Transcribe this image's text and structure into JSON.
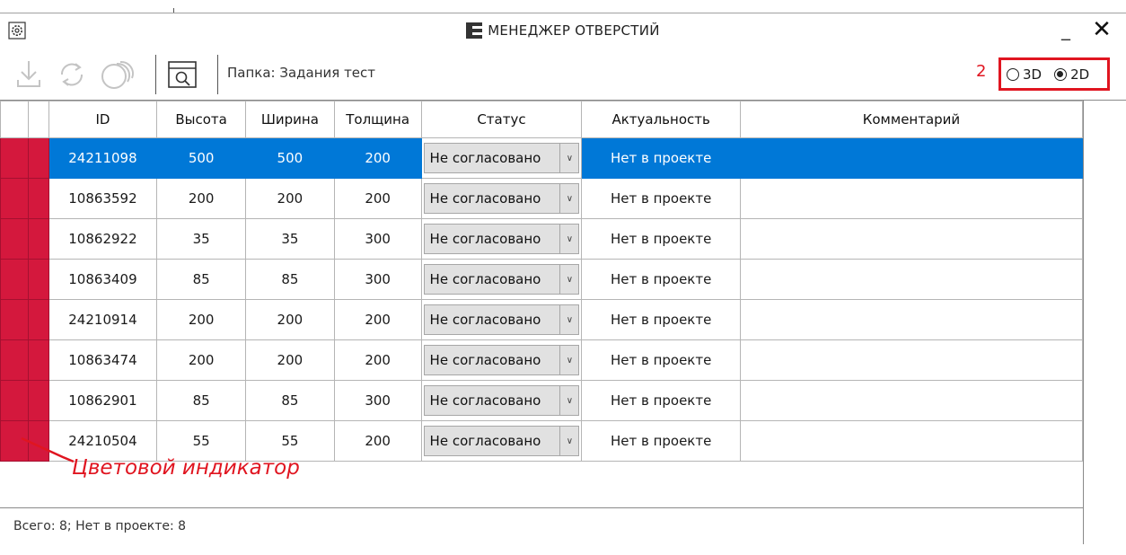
{
  "window": {
    "title": "МЕНЕДЖЕР ОТВЕРСТИЙ",
    "minimize": "_",
    "close": "✕"
  },
  "toolbar": {
    "folder_label": "Папка: Задания тест",
    "icons": [
      "download-icon",
      "refresh-icon",
      "circles-icon",
      "folder-search-icon"
    ],
    "annotation_number": "2",
    "mode": {
      "opt3d": "3D",
      "opt2d": "2D",
      "selected": "2D"
    }
  },
  "grid": {
    "headers": [
      "ID",
      "Высота",
      "Ширина",
      "Толщина",
      "Статус",
      "Актуальность",
      "Комментарий"
    ],
    "rows": [
      {
        "id": "24211098",
        "h": "500",
        "w": "500",
        "t": "200",
        "status": "Не согласовано",
        "actual": "Нет в проекте",
        "comment": ""
      },
      {
        "id": "10863592",
        "h": "200",
        "w": "200",
        "t": "200",
        "status": "Не согласовано",
        "actual": "Нет в проекте",
        "comment": ""
      },
      {
        "id": "10862922",
        "h": "35",
        "w": "35",
        "t": "300",
        "status": "Не согласовано",
        "actual": "Нет в проекте",
        "comment": ""
      },
      {
        "id": "10863409",
        "h": "85",
        "w": "85",
        "t": "300",
        "status": "Не согласовано",
        "actual": "Нет в проекте",
        "comment": ""
      },
      {
        "id": "24210914",
        "h": "200",
        "w": "200",
        "t": "200",
        "status": "Не согласовано",
        "actual": "Нет в проекте",
        "comment": ""
      },
      {
        "id": "10863474",
        "h": "200",
        "w": "200",
        "t": "200",
        "status": "Не согласовано",
        "actual": "Нет в проекте",
        "comment": ""
      },
      {
        "id": "10862901",
        "h": "85",
        "w": "85",
        "t": "300",
        "status": "Не согласовано",
        "actual": "Нет в проекте",
        "comment": ""
      },
      {
        "id": "24210504",
        "h": "55",
        "w": "55",
        "t": "200",
        "status": "Не согласовано",
        "actual": "Нет в проекте",
        "comment": ""
      }
    ]
  },
  "annotation": {
    "label": "Цветовой индикатор"
  },
  "status_bar": {
    "text": "Всего: 8; Нет в проекте: 8"
  },
  "colors": {
    "indicator": "#d4183d",
    "selection": "#0078d7",
    "annotation": "#e01520"
  }
}
